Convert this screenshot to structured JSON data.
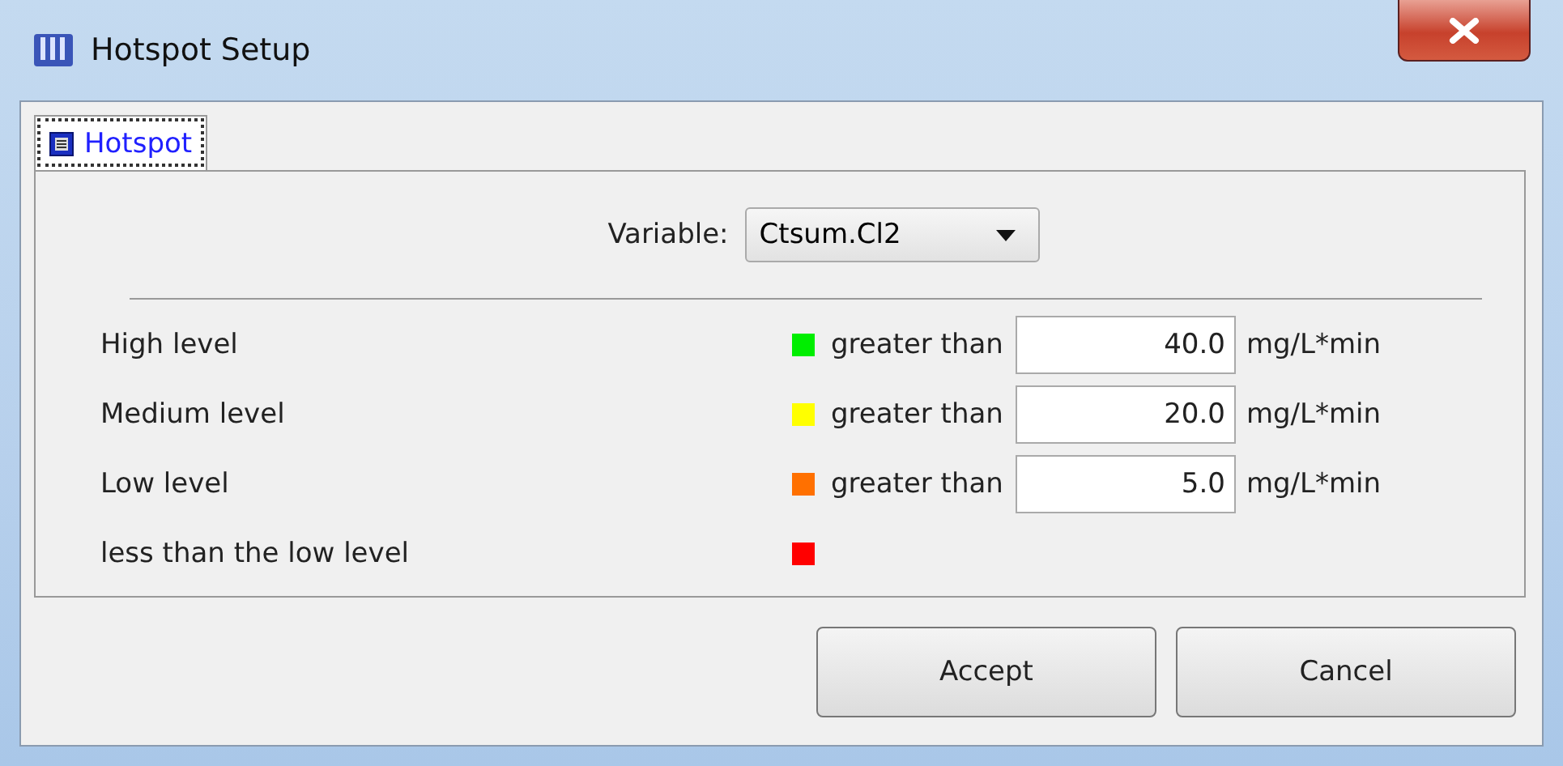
{
  "window": {
    "title": "Hotspot Setup"
  },
  "tabs": [
    {
      "label": "Hotspot",
      "selected": true
    }
  ],
  "variable": {
    "label": "Variable:",
    "value": "Ctsum.Cl2"
  },
  "levels": [
    {
      "label": "High level",
      "color": "#00ee00",
      "comparison": "greater than",
      "value": "40.0",
      "unit": "mg/L*min"
    },
    {
      "label": "Medium level",
      "color": "#ffff00",
      "comparison": "greater than",
      "value": "20.0",
      "unit": "mg/L*min"
    },
    {
      "label": "Low level",
      "color": "#ff7000",
      "comparison": "greater than",
      "value": "5.0",
      "unit": "mg/L*min"
    },
    {
      "label": "less than the low level",
      "color": "#ff0000"
    }
  ],
  "buttons": [
    "Accept",
    "Cancel"
  ]
}
